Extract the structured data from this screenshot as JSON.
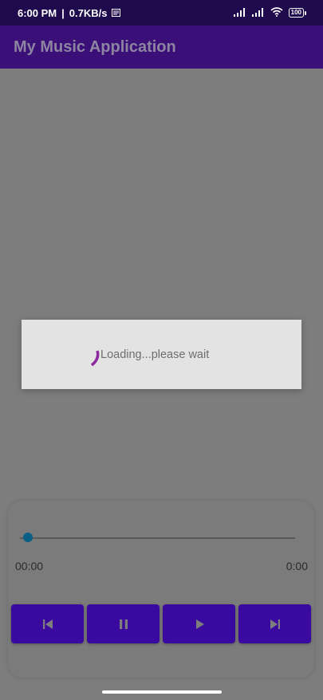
{
  "status_bar": {
    "time": "6:00 PM",
    "network_speed": "0.7KB/s",
    "battery": "100"
  },
  "app_bar": {
    "title": "My Music Application"
  },
  "loading_dialog": {
    "message": "Loading...please wait"
  },
  "player": {
    "current_time": "00:00",
    "total_time": "0:00",
    "progress": 0,
    "controls": [
      {
        "name": "previous",
        "icon": "skip-previous-icon"
      },
      {
        "name": "pause",
        "icon": "pause-icon"
      },
      {
        "name": "play",
        "icon": "play-icon"
      },
      {
        "name": "next",
        "icon": "skip-next-icon"
      }
    ]
  },
  "colors": {
    "app_bar": "#3a1078",
    "button": "#3a0aa0",
    "spinner": "#8e2aa0",
    "seek_thumb": "#0b5f86"
  }
}
